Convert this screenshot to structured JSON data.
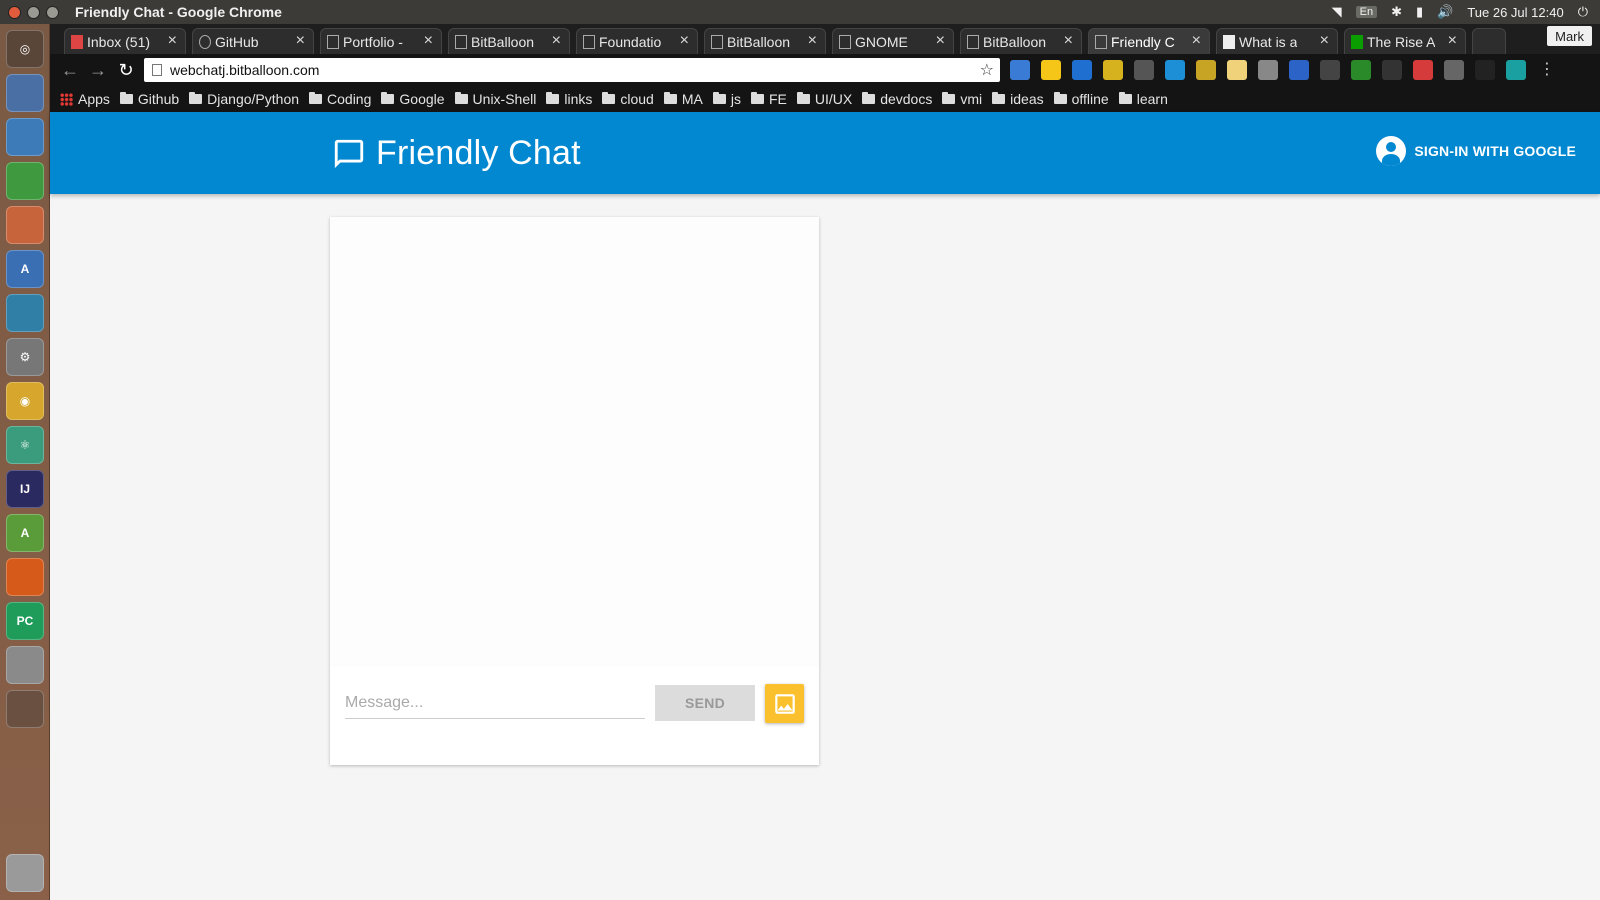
{
  "os": {
    "window_title": "Friendly Chat - Google Chrome",
    "language": "En",
    "datetime": "Tue 26 Jul 12:40"
  },
  "launcher": {
    "apps": [
      "ubuntu-dash",
      "files",
      "libreoffice-writer",
      "libreoffice-calc",
      "libreoffice-impress",
      "software-center",
      "app-unknown",
      "system-settings",
      "chrome",
      "atom",
      "intellij",
      "android-studio",
      "firefox",
      "pycharm",
      "disk",
      "workspace",
      "trash"
    ]
  },
  "browser": {
    "tabs": [
      {
        "label": "Inbox (51)"
      },
      {
        "label": "GitHub"
      },
      {
        "label": "Portfolio -"
      },
      {
        "label": "BitBalloon"
      },
      {
        "label": "Foundatio"
      },
      {
        "label": "BitBalloon"
      },
      {
        "label": "GNOME"
      },
      {
        "label": "BitBalloon"
      },
      {
        "label": "Friendly C"
      },
      {
        "label": "What is a"
      },
      {
        "label": "The Rise A"
      }
    ],
    "active_tab": 8,
    "profile_name": "Mark",
    "url": "webchatj.bitballoon.com",
    "bookmarks": [
      "Apps",
      "Github",
      "Django/Python",
      "Coding",
      "Google",
      "Unix-Shell",
      "links",
      "cloud",
      "MA",
      "js",
      "FE",
      "UI/UX",
      "devdocs",
      "vmi",
      "ideas",
      "offline",
      "learn"
    ]
  },
  "app": {
    "title": "Friendly Chat",
    "signin_label": "SIGN-IN WITH GOOGLE",
    "message_placeholder": "Message...",
    "send_label": "SEND"
  },
  "colors": {
    "header": "#0288d1",
    "image_button": "#fbc02d",
    "send_disabled": "#dcdcdc"
  }
}
